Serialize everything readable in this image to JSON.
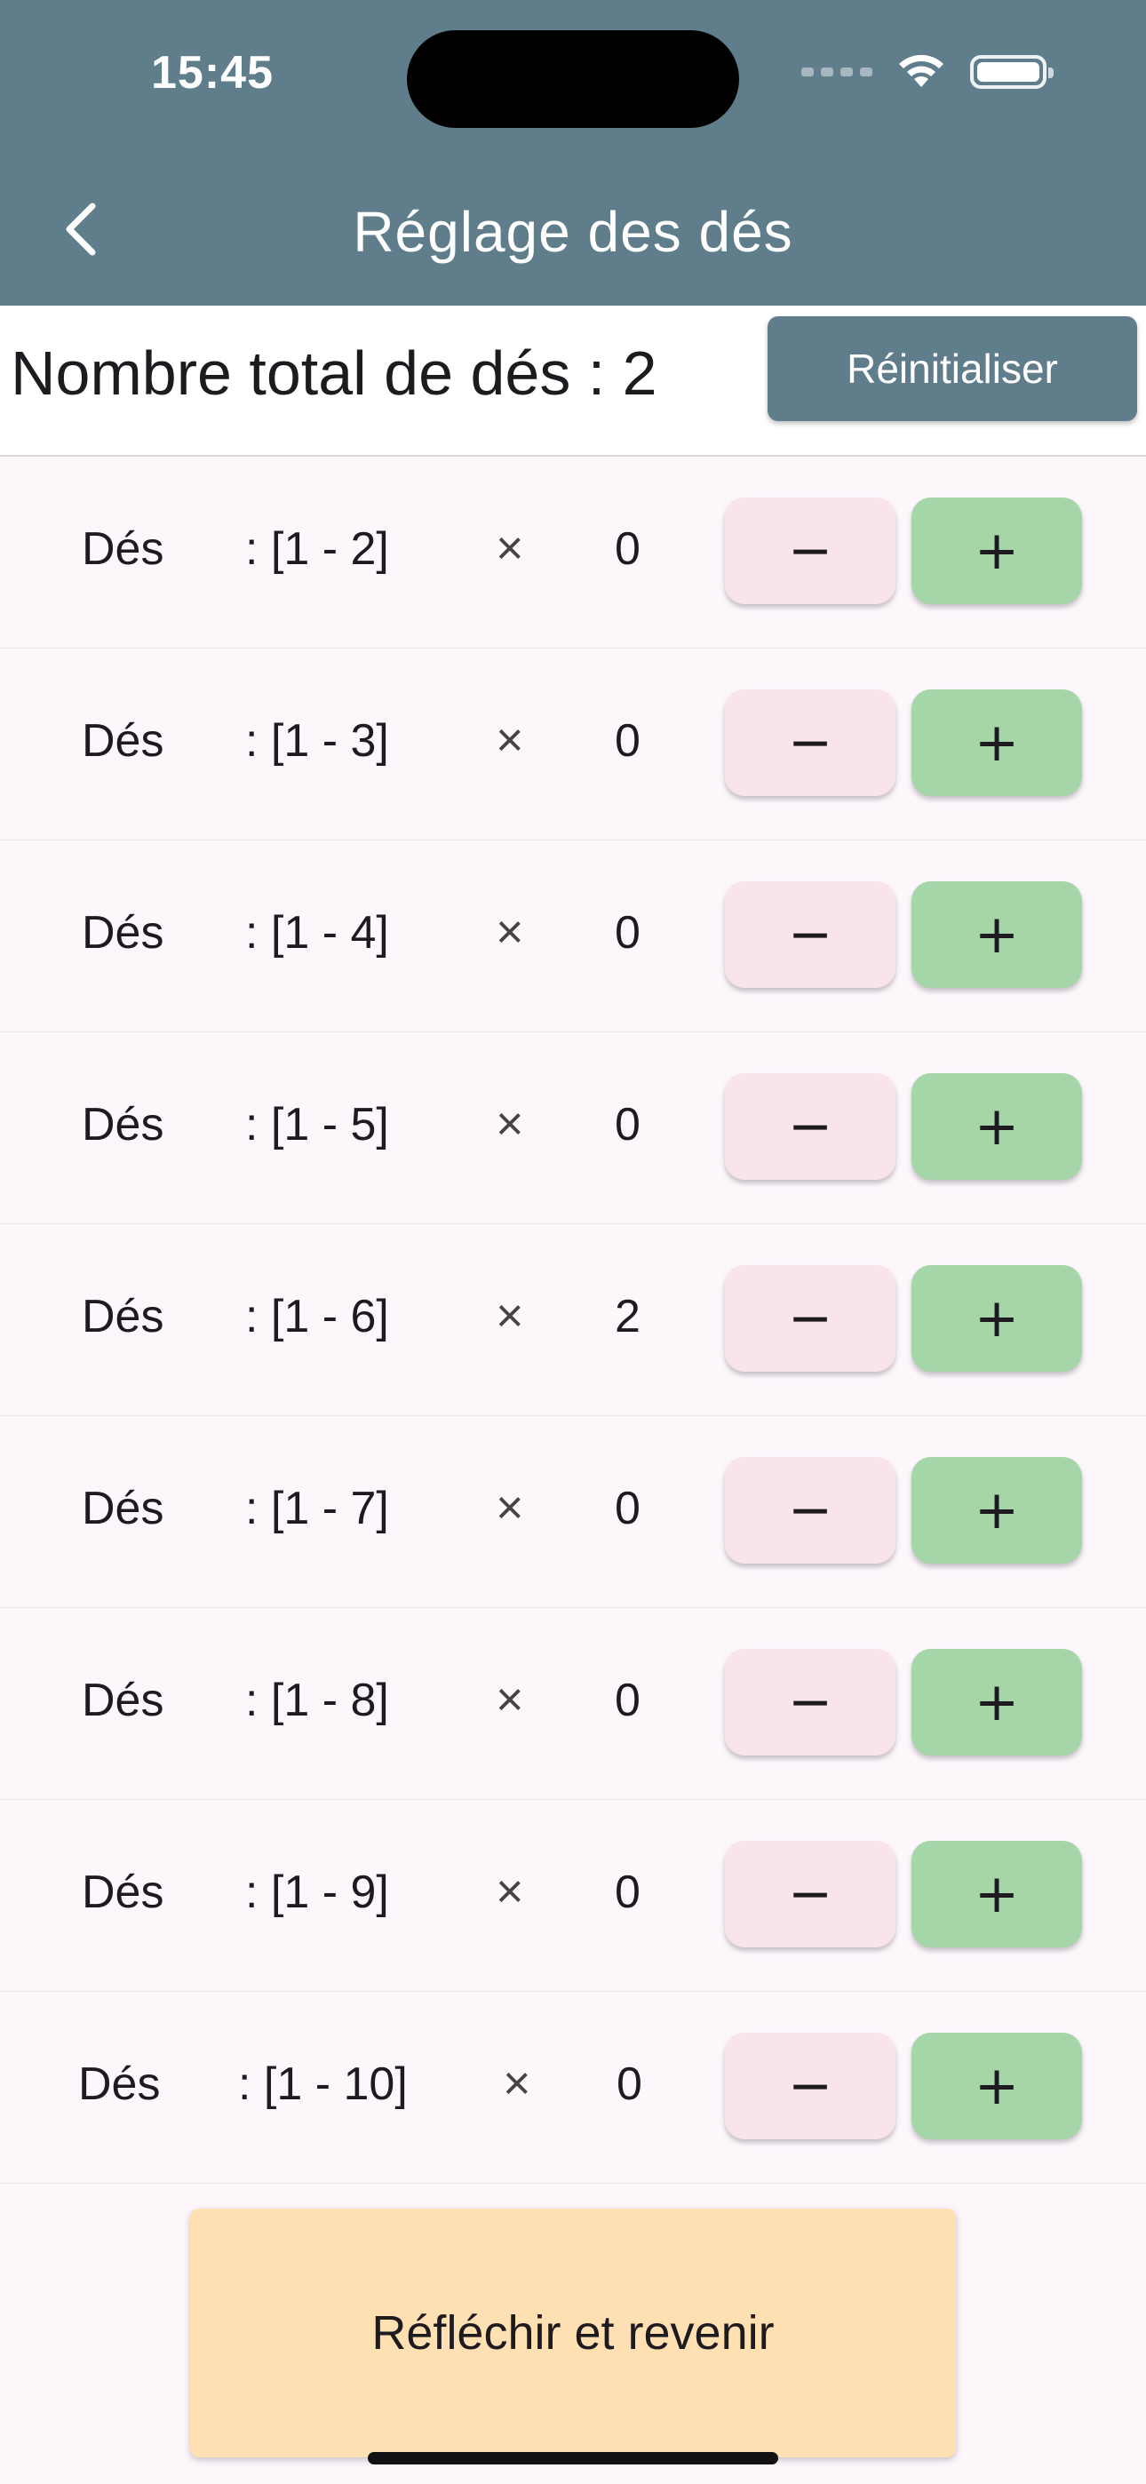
{
  "status_bar": {
    "time": "15:45"
  },
  "app_bar": {
    "title": "Réglage des dés",
    "back_icon": "chevron-left-icon"
  },
  "summary": {
    "total_label": "Nombre total de dés : 2",
    "reset_label": "Réinitialiser"
  },
  "dice_rows": [
    {
      "label": "Dés",
      "range": ": [1 - 2]",
      "times": "×",
      "count": "0",
      "minus": "−",
      "plus": "+"
    },
    {
      "label": "Dés",
      "range": ": [1 - 3]",
      "times": "×",
      "count": "0",
      "minus": "−",
      "plus": "+"
    },
    {
      "label": "Dés",
      "range": ": [1 - 4]",
      "times": "×",
      "count": "0",
      "minus": "−",
      "plus": "+"
    },
    {
      "label": "Dés",
      "range": ": [1 - 5]",
      "times": "×",
      "count": "0",
      "minus": "−",
      "plus": "+"
    },
    {
      "label": "Dés",
      "range": ": [1 - 6]",
      "times": "×",
      "count": "2",
      "minus": "−",
      "plus": "+"
    },
    {
      "label": "Dés",
      "range": ": [1 - 7]",
      "times": "×",
      "count": "0",
      "minus": "−",
      "plus": "+"
    },
    {
      "label": "Dés",
      "range": ": [1 - 8]",
      "times": "×",
      "count": "0",
      "minus": "−",
      "plus": "+"
    },
    {
      "label": "Dés",
      "range": ": [1 - 9]",
      "times": "×",
      "count": "0",
      "minus": "−",
      "plus": "+"
    },
    {
      "label": "Dés",
      "range": ": [1 - 10]",
      "times": "×",
      "count": "0",
      "minus": "−",
      "plus": "+"
    }
  ],
  "footer": {
    "think_label": "Réfléchir et revenir"
  },
  "colors": {
    "app_bar": "#607d8b",
    "minus_button": "#f9e4ea",
    "plus_button": "#a5d6a7",
    "footer_button": "#ffe0b2"
  }
}
